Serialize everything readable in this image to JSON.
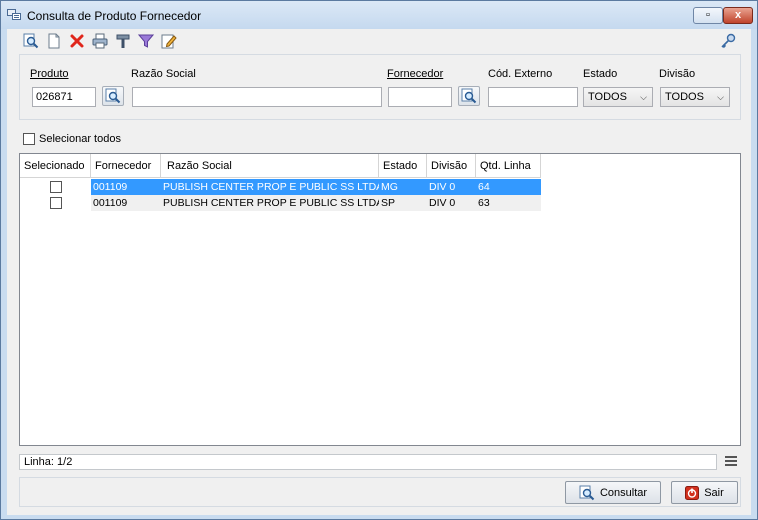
{
  "window": {
    "title": "Consulta de Produto Fornecedor",
    "controls": {
      "restore": "▫",
      "close": "x"
    }
  },
  "toolbar": {
    "items": [
      {
        "name": "search",
        "icon": "search-doc-icon"
      },
      {
        "name": "new",
        "icon": "new-doc-icon"
      },
      {
        "name": "delete",
        "icon": "delete-x-icon"
      },
      {
        "name": "print",
        "icon": "print-icon"
      },
      {
        "name": "tools",
        "icon": "tools-icon"
      },
      {
        "name": "filter",
        "icon": "filter-funnel-icon"
      },
      {
        "name": "edit",
        "icon": "edit-pencil-icon"
      }
    ],
    "right_icon": "key-icon"
  },
  "filters": {
    "produto": {
      "label": "Produto",
      "value": "026871"
    },
    "razao_social": {
      "label": "Razão Social",
      "value": ""
    },
    "fornecedor": {
      "label": "Fornecedor",
      "value": ""
    },
    "cod_externo": {
      "label": "Cód. Externo",
      "value": ""
    },
    "estado": {
      "label": "Estado",
      "value": "TODOS"
    },
    "divisao": {
      "label": "Divisão",
      "value": "TODOS"
    }
  },
  "select_all": {
    "label": "Selecionar todos",
    "checked": false
  },
  "grid": {
    "columns": [
      "Selecionado",
      "Fornecedor",
      "Razão Social",
      "Estado",
      "Divisão",
      "Qtd. Linha"
    ],
    "rows": [
      {
        "selecionado": false,
        "fornecedor": "001109",
        "razao_social": "PUBLISH CENTER PROP E PUBLIC SS LTDA",
        "estado": "MG",
        "divisao": "DIV 0",
        "qtd_linha": "64"
      },
      {
        "selecionado": false,
        "fornecedor": "001109",
        "razao_social": "PUBLISH CENTER PROP E PUBLIC SS LTDA",
        "estado": "SP",
        "divisao": "DIV 0",
        "qtd_linha": "63"
      }
    ],
    "selected_row_index": 0
  },
  "status": {
    "text": "Linha: 1/2"
  },
  "buttons": {
    "consultar": "Consultar",
    "sair": "Sair"
  },
  "colors": {
    "selection": "#3399ff",
    "title_bar": "#c9dcf0",
    "close_button": "#c0432b",
    "delete_icon": "#e0261b",
    "sair_icon": "#d2311f"
  }
}
